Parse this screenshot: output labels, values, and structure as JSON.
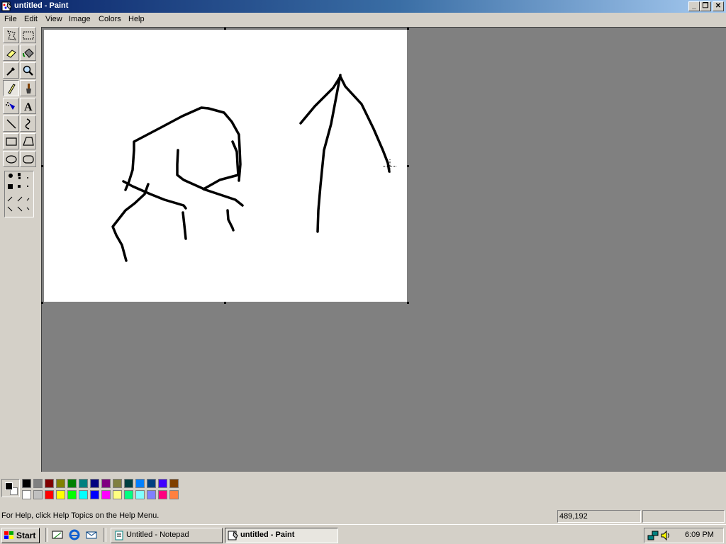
{
  "window": {
    "title": "untitled - Paint"
  },
  "caption_buttons": {
    "minimize": "_",
    "restore": "❐",
    "close": "✕"
  },
  "menu": [
    "File",
    "Edit",
    "View",
    "Image",
    "Colors",
    "Help"
  ],
  "tools": [
    "free-form-select",
    "select",
    "eraser",
    "fill-with-color",
    "pick-color",
    "magnifier",
    "pencil",
    "brush",
    "airbrush",
    "text",
    "line",
    "curve",
    "rectangle",
    "polygon",
    "ellipse",
    "rounded-rectangle"
  ],
  "active_tool": "pencil",
  "text_tool_glyph": "A",
  "palette": {
    "foreground": "#000000",
    "background": "#ffffff",
    "row1": [
      "#000000",
      "#808080",
      "#800000",
      "#808000",
      "#008000",
      "#008080",
      "#000080",
      "#800080",
      "#808040",
      "#004040",
      "#0080ff",
      "#004080",
      "#4000ff",
      "#804000"
    ],
    "row2": [
      "#ffffff",
      "#c0c0c0",
      "#ff0000",
      "#ffff00",
      "#00ff00",
      "#00ffff",
      "#0000ff",
      "#ff00ff",
      "#ffff80",
      "#00ff80",
      "#80ffff",
      "#8080ff",
      "#ff0080",
      "#ff8040"
    ]
  },
  "status": {
    "help": "For Help, click Help Topics on the Help Menu.",
    "coords": "489,192",
    "size": ""
  },
  "taskbar": {
    "start": "Start",
    "tasks": [
      {
        "label": "Untitled - Notepad",
        "active": false
      },
      {
        "label": "untitled - Paint",
        "active": true
      }
    ],
    "time": "6:09 PM"
  }
}
